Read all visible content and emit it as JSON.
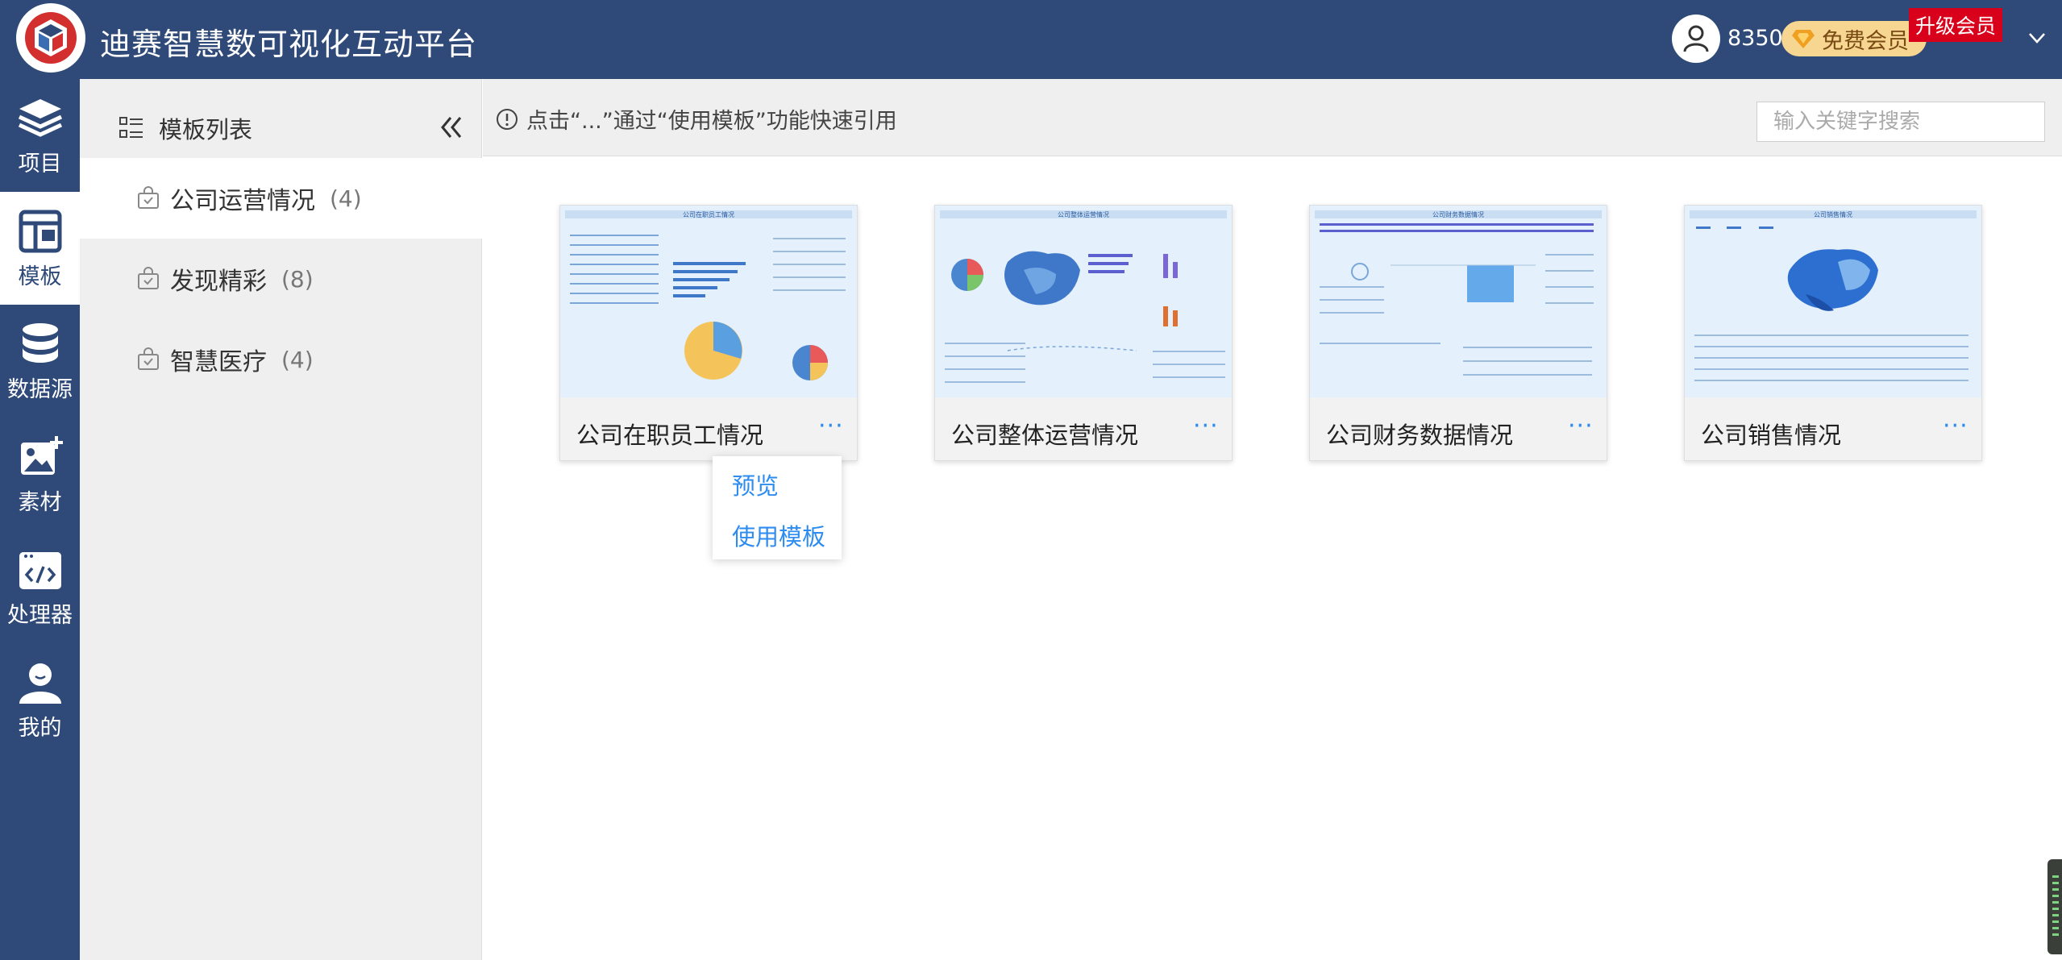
{
  "header": {
    "title": "迪赛智慧数可视化互动平台",
    "points": "8350",
    "member_label": "免费会员",
    "upgrade_label": "升级会员",
    "logo_icon": "cube-logo-icon",
    "brand_colors": {
      "header_bg": "#2f4a78",
      "link": "#2d8cf0",
      "upgrade": "#d9001b"
    }
  },
  "nav": {
    "items": [
      {
        "label": "项目",
        "icon": "layers-icon"
      },
      {
        "label": "模板",
        "icon": "template-icon",
        "active": true
      },
      {
        "label": "数据源",
        "icon": "database-icon"
      },
      {
        "label": "素材",
        "icon": "image-add-icon"
      },
      {
        "label": "处理器",
        "icon": "code-icon"
      },
      {
        "label": "我的",
        "icon": "user-icon"
      }
    ]
  },
  "panel": {
    "title": "模板列表",
    "categories": [
      {
        "name": "公司运营情况",
        "count": "(4)",
        "active": true
      },
      {
        "name": "发现精彩",
        "count": "(8)"
      },
      {
        "name": "智慧医疗",
        "count": "(4)"
      }
    ]
  },
  "toolbar": {
    "hint": "点击“...”通过“使用模板”功能快速引用",
    "search_placeholder": "输入关键字搜索"
  },
  "templates": [
    {
      "name": "公司在职员工情况",
      "more": "···",
      "thumb_title": "公司在职员工情况"
    },
    {
      "name": "公司整体运营情况",
      "more": "···",
      "thumb_title": "公司整体运营情况"
    },
    {
      "name": "公司财务数据情况",
      "more": "···",
      "thumb_title": "公司财务数据情况"
    },
    {
      "name": "公司销售情况",
      "more": "···",
      "thumb_title": "公司销售情况"
    }
  ],
  "menu": {
    "preview": "预览",
    "use_template": "使用模板"
  }
}
